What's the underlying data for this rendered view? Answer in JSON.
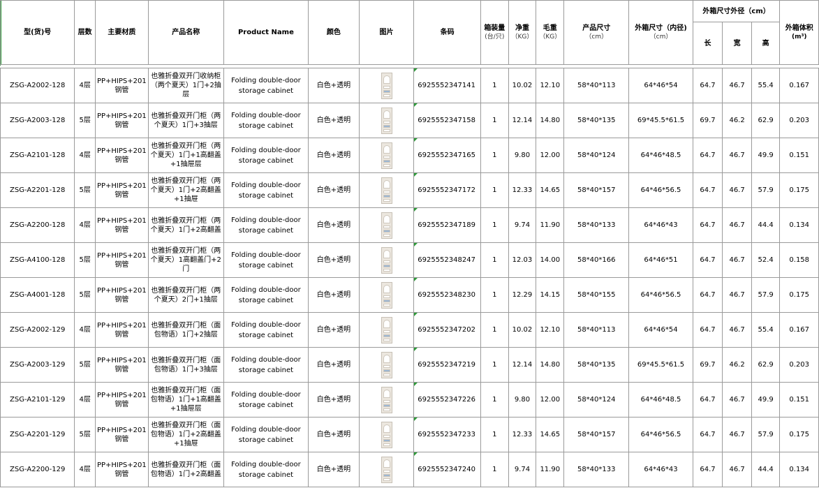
{
  "headers": {
    "model": "型(货)号",
    "layers": "层数",
    "material": "主要材质",
    "name_cn": "产品名称",
    "name_en": "Product Name",
    "color": "颜色",
    "picture": "图片",
    "barcode": "条码",
    "pack_qty": "箱装量",
    "pack_qty_unit": "(台/只)",
    "net_weight": "净重",
    "net_weight_unit": "（KG）",
    "gross_weight": "毛重",
    "gross_weight_unit": "（KG）",
    "product_size": "产品尺寸",
    "product_size_unit": "（cm）",
    "inner_size": "外箱尺寸（内径)",
    "inner_size_unit": "（cm）",
    "outer_size": "外箱尺寸外径（cm）",
    "length": "长",
    "width": "宽",
    "height": "高",
    "volume": "外箱体积",
    "volume_unit": "(m³)"
  },
  "rows": [
    {
      "model": "ZSG-A2002-128",
      "layers": "4层",
      "material": "PP+HIPS+201钢管",
      "name": "也雅折叠双开门收纳柜（两个夏天）1门+2抽层",
      "en": "Folding double-door storage cabinet",
      "color": "白色+透明",
      "barcode": "6925552347141",
      "qty": "1",
      "net": "10.02",
      "gross": "12.10",
      "psize": "58*40*113",
      "isize": "64*46*54",
      "l": "64.7",
      "w": "46.7",
      "h": "55.4",
      "vol": "0.167"
    },
    {
      "model": "ZSG-A2003-128",
      "layers": "5层",
      "material": "PP+HIPS+201钢管",
      "name": "也雅折叠双开门柜（两个夏天）1门+3抽层",
      "en": "Folding double-door storage cabinet",
      "color": "白色+透明",
      "barcode": "6925552347158",
      "qty": "1",
      "net": "12.14",
      "gross": "14.80",
      "psize": "58*40*135",
      "isize": "69*45.5*61.5",
      "l": "69.7",
      "w": "46.2",
      "h": "62.9",
      "vol": "0.203"
    },
    {
      "model": "ZSG-A2101-128",
      "layers": "4层",
      "material": "PP+HIPS+201钢管",
      "name": "也雅折叠双开门柜（两个夏天）1门+1高翻盖+1抽屉层",
      "en": "Folding double-door storage cabinet",
      "color": "白色+透明",
      "barcode": "6925552347165",
      "qty": "1",
      "net": "9.80",
      "gross": "12.00",
      "psize": "58*40*124",
      "isize": "64*46*48.5",
      "l": "64.7",
      "w": "46.7",
      "h": "49.9",
      "vol": "0.151"
    },
    {
      "model": "ZSG-A2201-128",
      "layers": "5层",
      "material": "PP+HIPS+201钢管",
      "name": "也雅折叠双开门柜（两个夏天）1门+2高翻盖+1抽屉",
      "en": "Folding double-door storage cabinet",
      "color": "白色+透明",
      "barcode": "6925552347172",
      "qty": "1",
      "net": "12.33",
      "gross": "14.65",
      "psize": "58*40*157",
      "isize": "64*46*56.5",
      "l": "64.7",
      "w": "46.7",
      "h": "57.9",
      "vol": "0.175"
    },
    {
      "model": "ZSG-A2200-128",
      "layers": "4层",
      "material": "PP+HIPS+201钢管",
      "name": "也雅折叠双开门柜（两个夏天）1门+2高翻盖",
      "en": "Folding double-door storage cabinet",
      "color": "白色+透明",
      "barcode": "6925552347189",
      "qty": "1",
      "net": "9.74",
      "gross": "11.90",
      "psize": "58*40*133",
      "isize": "64*46*43",
      "l": "64.7",
      "w": "46.7",
      "h": "44.4",
      "vol": "0.134"
    },
    {
      "model": "ZSG-A4100-128",
      "layers": "5层",
      "material": "PP+HIPS+201钢管",
      "name": "也雅折叠双开门柜（两个夏天）1高翻盖门+2门",
      "en": "Folding double-door storage cabinet",
      "color": "白色+透明",
      "barcode": "6925552348247",
      "qty": "1",
      "net": "12.03",
      "gross": "14.00",
      "psize": "58*40*166",
      "isize": "64*46*51",
      "l": "64.7",
      "w": "46.7",
      "h": "52.4",
      "vol": "0.158"
    },
    {
      "model": "ZSG-A4001-128",
      "layers": "5层",
      "material": "PP+HIPS+201钢管",
      "name": "也雅折叠双开门柜（两个夏天）2门+1抽层",
      "en": "Folding double-door storage cabinet",
      "color": "白色+透明",
      "barcode": "6925552348230",
      "qty": "1",
      "net": "12.29",
      "gross": "14.15",
      "psize": "58*40*155",
      "isize": "64*46*56.5",
      "l": "64.7",
      "w": "46.7",
      "h": "57.9",
      "vol": "0.175"
    },
    {
      "model": "ZSG-A2002-129",
      "layers": "4层",
      "material": "PP+HIPS+201钢管",
      "name": "也雅折叠双开门柜（面包物语）1门+2抽层",
      "en": "Folding double-door storage cabinet",
      "color": "白色+透明",
      "barcode": "6925552347202",
      "qty": "1",
      "net": "10.02",
      "gross": "12.10",
      "psize": "58*40*113",
      "isize": "64*46*54",
      "l": "64.7",
      "w": "46.7",
      "h": "55.4",
      "vol": "0.167"
    },
    {
      "model": "ZSG-A2003-129",
      "layers": "5层",
      "material": "PP+HIPS+201钢管",
      "name": "也雅折叠双开门柜（面包物语）1门+3抽层",
      "en": "Folding double-door storage cabinet",
      "color": "白色+透明",
      "barcode": "6925552347219",
      "qty": "1",
      "net": "12.14",
      "gross": "14.80",
      "psize": "58*40*135",
      "isize": "69*45.5*61.5",
      "l": "69.7",
      "w": "46.2",
      "h": "62.9",
      "vol": "0.203"
    },
    {
      "model": "ZSG-A2101-129",
      "layers": "4层",
      "material": "PP+HIPS+201钢管",
      "name": "也雅折叠双开门柜（面包物语）1门+1高翻盖+1抽屉层",
      "en": "Folding double-door storage cabinet",
      "color": "白色+透明",
      "barcode": "6925552347226",
      "qty": "1",
      "net": "9.80",
      "gross": "12.00",
      "psize": "58*40*124",
      "isize": "64*46*48.5",
      "l": "64.7",
      "w": "46.7",
      "h": "49.9",
      "vol": "0.151"
    },
    {
      "model": "ZSG-A2201-129",
      "layers": "5层",
      "material": "PP+HIPS+201钢管",
      "name": "也雅折叠双开门柜（面包物语）1门+2高翻盖+1抽屉",
      "en": "Folding double-door storage cabinet",
      "color": "白色+透明",
      "barcode": "6925552347233",
      "qty": "1",
      "net": "12.33",
      "gross": "14.65",
      "psize": "58*40*157",
      "isize": "64*46*56.5",
      "l": "64.7",
      "w": "46.7",
      "h": "57.9",
      "vol": "0.175"
    },
    {
      "model": "ZSG-A2200-129",
      "layers": "4层",
      "material": "PP+HIPS+201钢管",
      "name": "也雅折叠双开门柜（面包物语）1门+2高翻盖",
      "en": "Folding double-door storage cabinet",
      "color": "白色+透明",
      "barcode": "6925552347240",
      "qty": "1",
      "net": "9.74",
      "gross": "11.90",
      "psize": "58*40*133",
      "isize": "64*46*43",
      "l": "64.7",
      "w": "46.7",
      "h": "44.4",
      "vol": "0.134"
    }
  ],
  "colors": {
    "grid": "#9a9a9a",
    "selection": "#2e9b3a"
  },
  "icons": {
    "picture": "cabinet-thumbnail-icon"
  }
}
